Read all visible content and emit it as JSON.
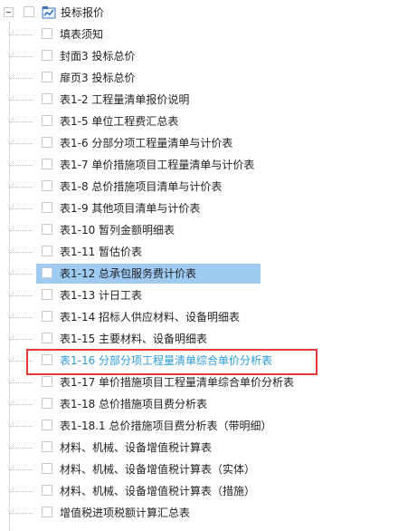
{
  "tree": {
    "root": {
      "label": "投标报价"
    },
    "items": [
      {
        "label": "填表须知",
        "state": "normal"
      },
      {
        "label": "封面3 投标总价",
        "state": "normal"
      },
      {
        "label": "扉页3 投标总价",
        "state": "normal"
      },
      {
        "label": "表1-2 工程量清单报价说明",
        "state": "normal"
      },
      {
        "label": "表1-5 单位工程费汇总表",
        "state": "normal"
      },
      {
        "label": "表1-6 分部分项工程量清单与计价表",
        "state": "normal"
      },
      {
        "label": "表1-7 单价措施项目工程量清单与计价表",
        "state": "normal"
      },
      {
        "label": "表1-8 总价措施项目清单与计价表",
        "state": "normal"
      },
      {
        "label": "表1-9 其他项目清单与计价表",
        "state": "normal"
      },
      {
        "label": "表1-10 暂列金额明细表",
        "state": "normal"
      },
      {
        "label": "表1-11 暂估价表",
        "state": "normal"
      },
      {
        "label": "表1-12 总承包服务费计价表",
        "state": "selected"
      },
      {
        "label": "表1-13 计日工表",
        "state": "normal"
      },
      {
        "label": "表1-14 招标人供应材料、设备明细表",
        "state": "normal"
      },
      {
        "label": "表1-15 主要材料、设备明细表",
        "state": "normal"
      },
      {
        "label": "表1-16 分部分项工程量清单综合单价分析表",
        "state": "highlighted"
      },
      {
        "label": "表1-17 单价措施项目工程量清单综合单价分析表",
        "state": "normal"
      },
      {
        "label": "表1-18 总价措施项目费分析表",
        "state": "normal"
      },
      {
        "label": "表1-18.1 总价措施项目费分析表（带明细）",
        "state": "normal"
      },
      {
        "label": "材料、机械、设备增值税计算表",
        "state": "normal"
      },
      {
        "label": "材料、机械、设备增值税计算表（实体）",
        "state": "normal"
      },
      {
        "label": "材料、机械、设备增值税计算表（措施）",
        "state": "normal"
      },
      {
        "label": "增值税进项税额计算汇总表",
        "state": "normal"
      }
    ]
  },
  "colors": {
    "selected_bg": "#9fcaf2",
    "highlight_text": "#2b9bd8",
    "annotation_box": "#e43c3c"
  }
}
